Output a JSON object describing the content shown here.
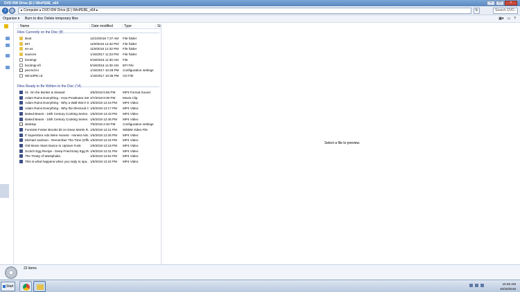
{
  "window": {
    "title": "DVD RW Drive (E:) WinPE8E_x64"
  },
  "address": {
    "crumb": "▸ Computer  ▸ DVD RW Drive (E:) WinPE8E_x64 ▸",
    "search_placeholder": "Search DVD..."
  },
  "toolbar": {
    "organize": "Organize ▾",
    "burn": "Burn to disc",
    "delete_temp": "Delete temporary files"
  },
  "columns": {
    "name": "Name",
    "date": "Date modified",
    "type": "Type",
    "size": "Size"
  },
  "group1": {
    "label": "Files Currently on the Disc (8)",
    "rows": [
      {
        "icon": "folder-icon",
        "name": "Boot",
        "date": "12/10/2016 7:27 AM",
        "type": "File folder"
      },
      {
        "icon": "folder-icon",
        "name": "EFI",
        "date": "11/9/2016 12:32 PM",
        "type": "File folder"
      },
      {
        "icon": "folder-icon",
        "name": "en-us",
        "date": "11/9/2016 12:32 PM",
        "type": "File folder"
      },
      {
        "icon": "folder-icon",
        "name": "sources",
        "date": "1/16/2017 11:23 PM",
        "type": "File folder"
      },
      {
        "icon": "file-icon",
        "name": "bootmgr",
        "date": "5/18/2016 11:30 AM",
        "type": "File"
      },
      {
        "icon": "file-icon",
        "name": "bootmgr.efi",
        "date": "5/18/2016 11:30 AM",
        "type": "EFI File"
      },
      {
        "icon": "config-icon",
        "name": "pecmd.ini",
        "date": "1/15/2017 10:28 PM",
        "type": "Configuration settings"
      },
      {
        "icon": "file-icon",
        "name": "Win10PE.cd",
        "date": "1/15/2017 10:35 PM",
        "type": "CD File"
      }
    ]
  },
  "group2": {
    "label": "Files Ready to Be Written to the Disc (14)",
    "rows": [
      {
        "icon": "media-icon",
        "name": "01. On the Border & Stewart",
        "date": "3/6/2019 5:55 PM",
        "type": "MP3 Format Sound"
      },
      {
        "icon": "media-icon",
        "name": "Adam Ruins Everything - How Prostitutes Set...",
        "date": "3/7/2019 8:30 PM",
        "type": "Movie Clip"
      },
      {
        "icon": "media-icon",
        "name": "Adam Ruins Everything - Why a Wall Won't S...",
        "date": "1/6/2019 12:16 PM",
        "type": "MP4 Video"
      },
      {
        "icon": "media-icon",
        "name": "Adam Ruins Everything - Why the Electoral C...",
        "date": "1/6/2019 12:17 PM",
        "type": "MP4 Video"
      },
      {
        "icon": "media-icon",
        "name": "Baked Beans - 18th Century Cooking Series ...",
        "date": "1/6/2019 12:43 PM",
        "type": "MP4 Video"
      },
      {
        "icon": "media-icon",
        "name": "Baked Beans - 18th Century Cooking Series ...",
        "date": "1/6/2019 12:46 PM",
        "type": "MP4 Video"
      },
      {
        "icon": "config-icon",
        "name": "desktop",
        "date": "7/5/2019 2:40 PM",
        "type": "Configuration settings"
      },
      {
        "icon": "media-icon",
        "name": "Funniest Foster Brooks bit on Dean Martin R...",
        "date": "1/6/2019 12:21 PM",
        "type": "WEBM Video File"
      },
      {
        "icon": "media-icon",
        "name": "If Superstore Ads Were Honest - Honest Ads...",
        "date": "1/6/2019 12:26 PM",
        "type": "MP4 Video"
      },
      {
        "icon": "media-icon",
        "name": "Michael Jackson - Remember The Time (Offic...",
        "date": "1/6/2019 12:34 PM",
        "type": "MP4 Video"
      },
      {
        "icon": "media-icon",
        "name": "Old Movie Stars Dance to Uptown Funk",
        "date": "1/6/2019 12:18 PM",
        "type": "MP4 Video"
      },
      {
        "icon": "media-icon",
        "name": "Scotch Egg Recipe - Deep Fried Easy Egg Re...",
        "date": "1/6/2019 12:31 PM",
        "type": "MP4 Video"
      },
      {
        "icon": "media-icon",
        "name": "The Treaty of Westphalia",
        "date": "1/6/2019 12:52 PM",
        "type": "MP4 Video"
      },
      {
        "icon": "media-icon",
        "name": "This is what happens when you reply to spa...",
        "date": "1/6/2019 12:24 PM",
        "type": "MP4 Video"
      }
    ]
  },
  "preview": {
    "message": "Select a file to preview."
  },
  "details": {
    "count": "22 items"
  },
  "taskbar": {
    "start": "Start",
    "time": "10:45 AM",
    "date": "10/20/2019"
  }
}
